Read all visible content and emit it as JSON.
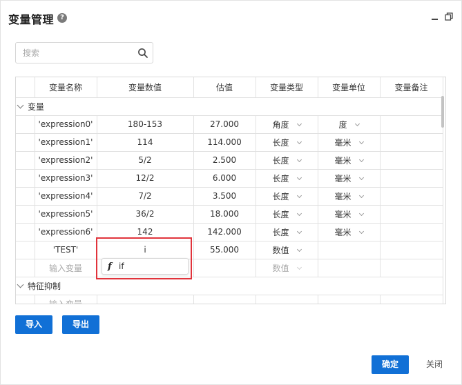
{
  "window": {
    "title": "变量管理",
    "help_glyph": "?"
  },
  "search": {
    "placeholder": "搜索",
    "value": ""
  },
  "table": {
    "columns": [
      "变量名称",
      "变量数值",
      "估值",
      "变量类型",
      "变量单位",
      "变量备注"
    ],
    "groups": [
      {
        "label": "变量"
      },
      {
        "label": "特征抑制"
      }
    ],
    "rows": [
      {
        "name": "'expression0'",
        "value": "180-153",
        "estimate": "27.000",
        "type": "角度",
        "unit": "度",
        "note": ""
      },
      {
        "name": "'expression1'",
        "value": "114",
        "estimate": "114.000",
        "type": "长度",
        "unit": "毫米",
        "note": ""
      },
      {
        "name": "'expression2'",
        "value": "5/2",
        "estimate": "2.500",
        "type": "长度",
        "unit": "毫米",
        "note": ""
      },
      {
        "name": "'expression3'",
        "value": "12/2",
        "estimate": "6.000",
        "type": "长度",
        "unit": "毫米",
        "note": ""
      },
      {
        "name": "'expression4'",
        "value": "7/2",
        "estimate": "3.500",
        "type": "长度",
        "unit": "毫米",
        "note": ""
      },
      {
        "name": "'expression5'",
        "value": "36/2",
        "estimate": "18.000",
        "type": "长度",
        "unit": "毫米",
        "note": ""
      },
      {
        "name": "'expression6'",
        "value": "142",
        "estimate": "142.000",
        "type": "长度",
        "unit": "毫米",
        "note": ""
      },
      {
        "name": "'TEST'",
        "value": "i",
        "estimate": "55.000",
        "type": "数值",
        "unit": "",
        "note": ""
      }
    ],
    "new_row": {
      "name_placeholder": "输入变量",
      "type_placeholder": "数值"
    },
    "new_row_2": {
      "name_placeholder": "输入变量"
    }
  },
  "suggestion": {
    "icon": "function-icon",
    "icon_glyph": "f",
    "text": "if"
  },
  "buttons": {
    "import": "导入",
    "export": "导出",
    "ok": "确定",
    "close": "关闭"
  },
  "colors": {
    "primary": "#1170d6",
    "edit_border": "#e1333b"
  }
}
